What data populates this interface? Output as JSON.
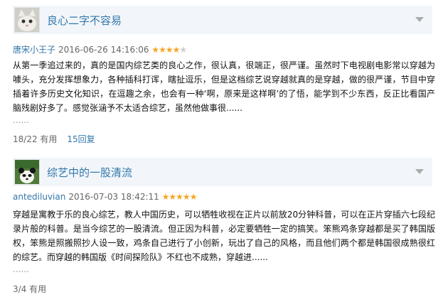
{
  "reviews": [
    {
      "title": "良心二字不容易",
      "author": "唐宋小王子",
      "date": "2016-06-26 14:16:06",
      "rating": 4,
      "content": "从第一季追过来的，真的是国内综艺类的良心之作，很认真，很端正，很严谨。虽然时下电视剧电影常以穿越为噱头，充分发挥想象力，各种插科打诨，瞎扯逗乐，但是这档综艺说穿越就真的是穿越，做的很严谨，节目中穿插着许多历史文化知识，在逗趣之余，也会有一种‘啊，原来是这样啊’的了悟，能学到不少东西，反正比看国产脑残剧好多了。感觉张涵予不太适合综艺，虽然他做事很......",
      "more": "......",
      "useful": "18/22 有用",
      "reply": "15回复"
    },
    {
      "title": "综艺中的一股清流",
      "author": "antediluvian",
      "date": "2016-07-03 18:42:11",
      "rating": 5,
      "content": "穿越是寓教于乐的良心综艺，教人中国历史，可以牺牲收视在正片以前放20分钟科普，可以在正片穿插六七段纪录片般的科普。是当今综艺的一股清流。但正因为科普，必定要牺牲一定的搞笑。笨熊鸡条穿越都是买了韩国版权，笨熊是照搬照抄人设一致，鸡条自己进行了小创新，玩出了自己的风格，而且他们两个都是韩国很成熟很红的综艺。而穿越的韩国版《时间探险队》不红也不成熟，穿越进......",
      "more": "......",
      "useful": "3/4 有用",
      "reply": ""
    }
  ],
  "colors": {
    "link": "#3377aa",
    "star": "#f6a623",
    "title_bg": "#f2f6fa"
  },
  "icons": {
    "toggle": "chevron-down-icon",
    "avatar1": "cat-avatar",
    "avatar2": "panda-avatar"
  }
}
